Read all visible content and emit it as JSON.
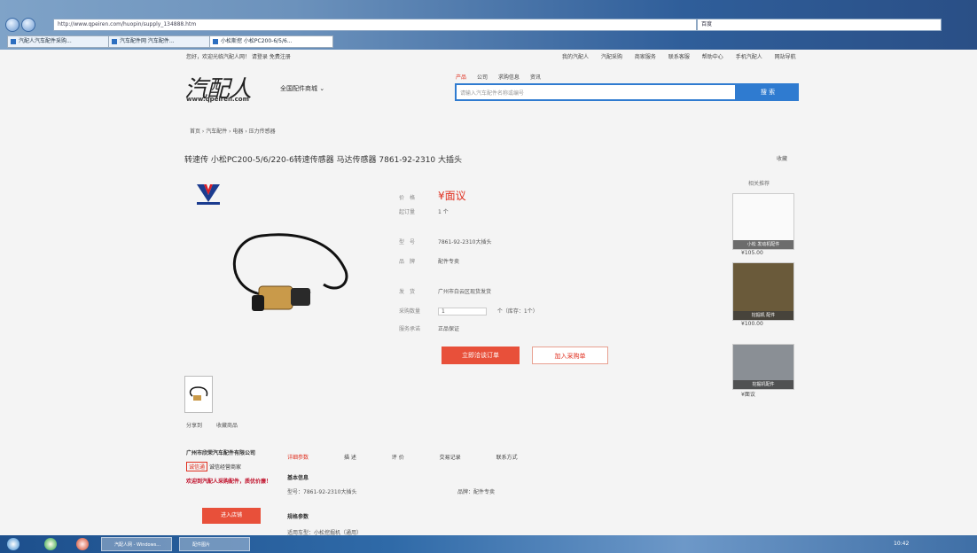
{
  "browser": {
    "url": "http://www.qpeiren.com/huopin/supply_134888.htm",
    "search_value": "百度",
    "tabs": [
      {
        "label": "汽配人汽车配件采购..."
      },
      {
        "label": "汽车配件网 汽车配件..."
      },
      {
        "label": "小松斯挖 小松PC200-6/5/6..."
      }
    ]
  },
  "site": {
    "topbar_left": "您好，欢迎光临汽配人网！ 请登录 免费注册",
    "topbar_right": [
      "我的汽配人",
      "汽配采购",
      "商家服务",
      "联系客服",
      "帮助中心",
      "手机汽配人",
      "网站导航"
    ],
    "logo_text": "汽配人",
    "logo_domain": "www.qpeiren.com",
    "city": "全国配件商城 ⌄",
    "search_tabs": [
      "产品",
      "公司",
      "求购信息",
      "资讯"
    ],
    "search_placeholder": "请输入汽车配件名称或编号",
    "search_button": "搜 索",
    "breadcrumb": "首页 › 汽车配件 › 电器 › 压力传感器"
  },
  "product": {
    "title": "转速传 小松PC200-5/6/220-6转速传感器 马达传感器 7861-92-2310 大插头",
    "collect": "收藏",
    "price_label": "价　格",
    "price": "¥面议",
    "stock_label": "起订量",
    "stock": "1 个",
    "model_label": "型　号",
    "model": "7861-92-2310大插头",
    "brand_label": "品　牌",
    "brand": "配件专卖",
    "ship_label": "发　货",
    "ship": "广州市白云区现货发货",
    "qty_label": "采购数量",
    "qty": "1",
    "qty_note": "个（库存：1个）",
    "service_label": "服务承诺",
    "service": "正品保证",
    "buy_button": "立即洽谈订单",
    "cart_button": "加入采购单",
    "share": [
      "分享到",
      "收藏商品"
    ]
  },
  "sidebar": {
    "label": "相关推荐",
    "items": [
      {
        "caption": "小松 发动机配件",
        "price": "¥105.00"
      },
      {
        "caption": "挖掘机 配件",
        "price": "¥100.00"
      },
      {
        "caption": "挖掘机配件",
        "price": "¥面议"
      }
    ]
  },
  "seller": {
    "name": "广州市欣荣汽车配件有限公司",
    "tag": "诚信通",
    "tag_note": "诚信经营商家",
    "promo": "欢迎到汽配人采购配件，质优价廉！",
    "button": "进入店铺"
  },
  "details": {
    "tabs": [
      "详细参数",
      "描 述",
      "评 价",
      "交易记录",
      "联系方式"
    ],
    "spec_title": "基本信息",
    "spec_model": "型号：7861-92-2310大插头",
    "spec_brand": "品牌：配件专卖",
    "spec_title2": "规格参数",
    "spec_row3": "适用车型：小松挖掘机（通用）"
  },
  "taskbar": {
    "tasks": [
      "汽配人网 - Windows...",
      "配件图片"
    ],
    "clock": "10:42"
  }
}
